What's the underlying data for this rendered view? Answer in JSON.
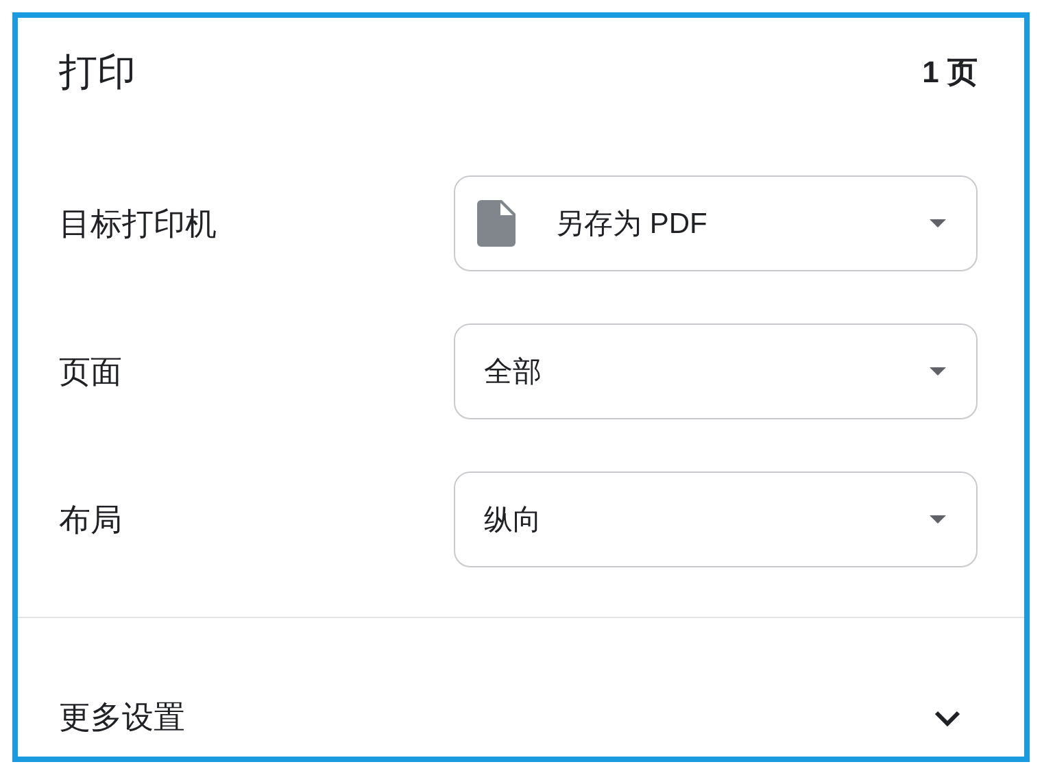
{
  "title": "打印",
  "page_count": "1 页",
  "settings": [
    {
      "kind": "destination",
      "label": "目标打印机",
      "value": "另存为 PDF"
    },
    {
      "kind": "plain",
      "label": "页面",
      "value": "全部"
    },
    {
      "kind": "plain",
      "label": "布局",
      "value": "纵向"
    }
  ],
  "more_settings": {
    "label": "更多设置",
    "expanded": false
  }
}
